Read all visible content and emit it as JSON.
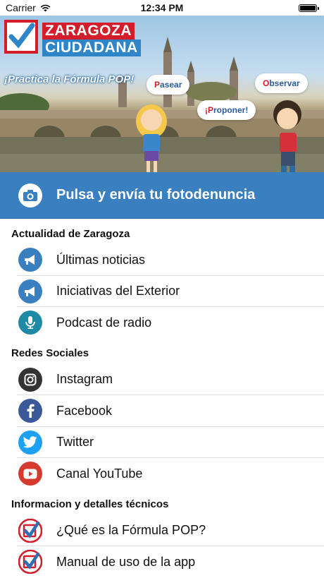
{
  "status_bar": {
    "carrier": "Carrier",
    "time": "12:34 PM",
    "battery_level": 1.0
  },
  "banner": {
    "logo_line1": "ZARAGOZA",
    "logo_line2": "CIUDADANA",
    "slogan": "¡Practica la Fórmula POP!",
    "bubbles": [
      {
        "first": "P",
        "rest": "asear"
      },
      {
        "first": "O",
        "rest": "bservar"
      },
      {
        "first": "¡P",
        "rest": "roponer!"
      }
    ]
  },
  "cta": {
    "label": "Pulsa y envía tu fotodenuncia",
    "icon": "camera-icon"
  },
  "sections": [
    {
      "title": "Actualidad de Zaragoza",
      "items": [
        {
          "label": "Últimas noticias",
          "icon": "megaphone-icon",
          "color": "#3a7fbf"
        },
        {
          "label": "Iniciativas del Exterior",
          "icon": "megaphone-icon",
          "color": "#3a7fbf"
        },
        {
          "label": "Podcast de radio",
          "icon": "microphone-icon",
          "color": "#1f8aa6"
        }
      ]
    },
    {
      "title": "Redes Sociales",
      "items": [
        {
          "label": "Instagram",
          "icon": "instagram-icon",
          "color": "#333333"
        },
        {
          "label": "Facebook",
          "icon": "facebook-icon",
          "color": "#3b5998"
        },
        {
          "label": "Twitter",
          "icon": "twitter-icon",
          "color": "#1da1f2"
        },
        {
          "label": "Canal YouTube",
          "icon": "youtube-icon",
          "color": "#d63a2e"
        }
      ]
    },
    {
      "title": "Informacion y detalles técnicos",
      "items": [
        {
          "label": "¿Qué es la Fórmula POP?",
          "icon": "pop-check-icon",
          "color": "#3a7fbf"
        },
        {
          "label": "Manual de uso de la app",
          "icon": "pop-check-icon",
          "color": "#3a7fbf"
        }
      ]
    }
  ]
}
